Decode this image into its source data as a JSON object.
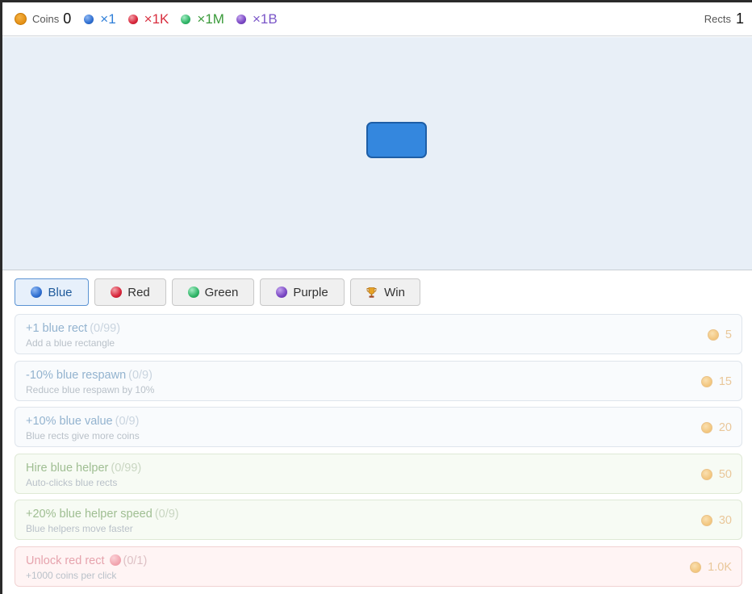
{
  "header": {
    "coins_label": "Coins",
    "coins_value": "0",
    "multipliers": [
      {
        "color": "blue",
        "label": "×1"
      },
      {
        "color": "red",
        "label": "×1K"
      },
      {
        "color": "green",
        "label": "×1M"
      },
      {
        "color": "purple",
        "label": "×1B"
      }
    ],
    "rects_label": "Rects",
    "rects_value": "1"
  },
  "tabs": [
    {
      "label": "Blue",
      "icon": "blue-ball-icon",
      "active": true
    },
    {
      "label": "Red",
      "icon": "red-ball-icon",
      "active": false
    },
    {
      "label": "Green",
      "icon": "green-ball-icon",
      "active": false
    },
    {
      "label": "Purple",
      "icon": "purple-ball-icon",
      "active": false
    },
    {
      "label": "Win",
      "icon": "trophy-icon",
      "active": false
    }
  ],
  "upgrades": [
    {
      "title": "+1 blue rect",
      "count": "(0/99)",
      "desc": "Add a blue rectangle",
      "price": "5"
    },
    {
      "title": "-10% blue respawn",
      "count": "(0/9)",
      "desc": "Reduce blue respawn by 10%",
      "price": "15"
    },
    {
      "title": "+10% blue value",
      "count": "(0/9)",
      "desc": "Blue rects give more coins",
      "price": "20"
    },
    {
      "title": "Hire blue helper",
      "count": "(0/99)",
      "desc": "Auto-clicks blue rects",
      "price": "50"
    },
    {
      "title": "+20% blue helper speed",
      "count": "(0/9)",
      "desc": "Blue helpers move faster",
      "price": "30"
    },
    {
      "title": "Unlock red rect",
      "count": "(0/1)",
      "desc": "+1000 coins per click",
      "price": "1.0K"
    }
  ],
  "colors": {
    "blue_rect": "#3487de",
    "play_area_bg": "#e8eff7",
    "coin": "#e38f14"
  }
}
